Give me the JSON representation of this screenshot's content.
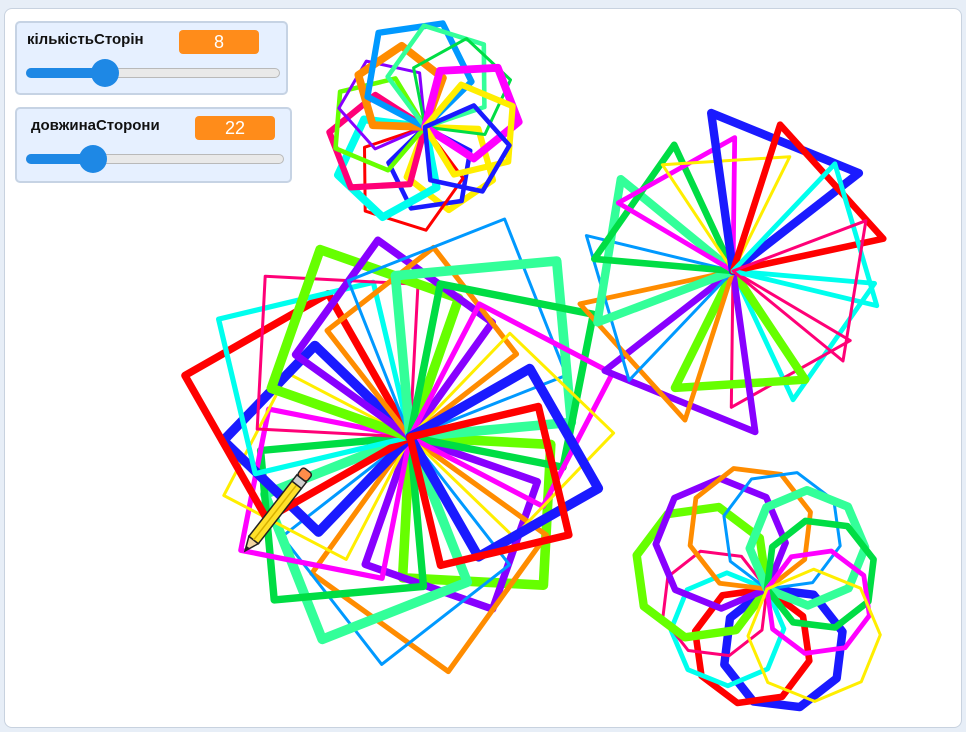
{
  "monitors": [
    {
      "label": "кількістьСторін",
      "value": "8",
      "slider_fraction": 0.31
    },
    {
      "label": "довжинаСторони",
      "value": "22",
      "slider_fraction": 0.26
    }
  ],
  "colors": {
    "monitor_value_bg": "#ff8c1a",
    "slider_accent": "#1e88e5",
    "monitor_bg": "#e6f0ff"
  },
  "sprite": {
    "icon": "pencil-icon"
  }
}
